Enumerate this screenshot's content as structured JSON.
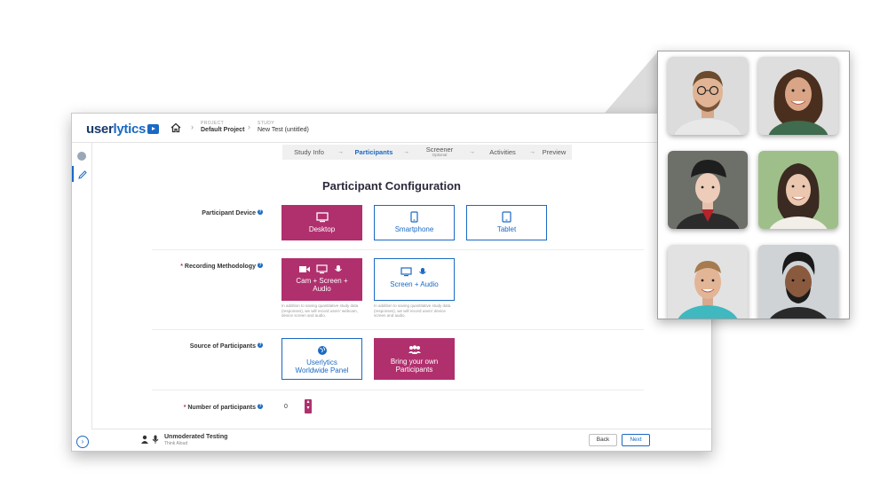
{
  "app": {
    "logo_user": "user",
    "logo_lytics": "lytics",
    "breadcrumb": [
      {
        "small": "PROJECT",
        "value": "Default Project"
      },
      {
        "small": "STUDY",
        "value": "New Test (untitled)"
      }
    ]
  },
  "steps": [
    {
      "label": "Study Info",
      "active": false,
      "sub": ""
    },
    {
      "label": "Participants",
      "active": true,
      "sub": ""
    },
    {
      "label": "Screener",
      "active": false,
      "sub": "Optional"
    },
    {
      "label": "Activities",
      "active": false,
      "sub": ""
    },
    {
      "label": "Preview",
      "active": false,
      "sub": ""
    }
  ],
  "step_arrow": "→",
  "title": "Participant Configuration",
  "rows": {
    "device": {
      "label": "Participant Device",
      "required_mark": "",
      "options": [
        {
          "label": "Desktop",
          "icon": "monitor-icon",
          "selected": true
        },
        {
          "label": "Smartphone",
          "icon": "smartphone-icon",
          "selected": false
        },
        {
          "label": "Tablet",
          "icon": "tablet-icon",
          "selected": false
        }
      ]
    },
    "recording": {
      "label": "Recording Methodology",
      "required_mark": "*",
      "options": [
        {
          "label": "Cam + Screen + Audio",
          "selected": true,
          "note": "In addition to saving quantitative study data (responses), we will record users' webcam, device screen and audio."
        },
        {
          "label": "Screen + Audio",
          "selected": false,
          "note": "In addition to saving quantitative study data (responses), we will record users' device screen and audio."
        }
      ]
    },
    "source": {
      "label": "Source of Participants",
      "required_mark": "",
      "options": [
        {
          "label": "Userlytics Worldwide Panel",
          "icon": "globe-icon",
          "selected": false
        },
        {
          "label": "Bring your own Participants",
          "icon": "users-icon",
          "selected": true
        }
      ]
    },
    "number": {
      "label": "Number of participants",
      "required_mark": "*",
      "value": "0"
    }
  },
  "help_mark": "?",
  "footer": {
    "title": "Unmoderated Testing",
    "subtitle": "Think Aloud",
    "back_label": "Back",
    "next_label": "Next"
  },
  "colors": {
    "accent": "#1a69c4",
    "selected": "#b0306e"
  }
}
